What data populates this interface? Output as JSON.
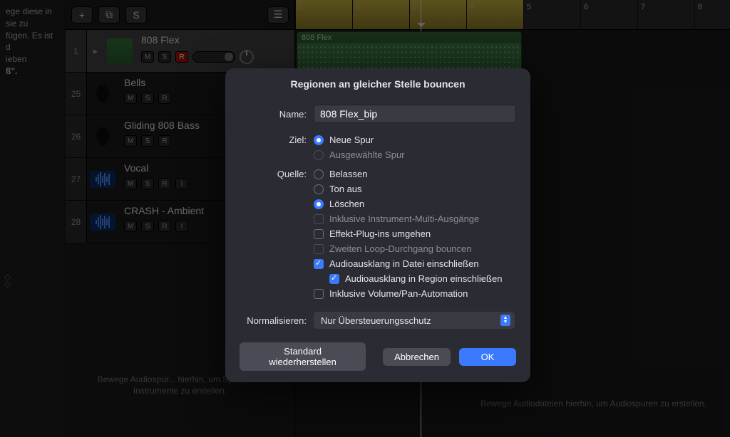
{
  "leftPanel": {
    "hint_lines": [
      "ege diese in",
      "sie zu",
      "fügen. Es ist",
      "d",
      "ieben",
      "ß\"."
    ]
  },
  "toolbar": {
    "add": "+",
    "dup": "⧉",
    "solo": "S",
    "list": "☰"
  },
  "tracks": [
    {
      "index": "1",
      "name": "808 Flex",
      "iconType": "drumpad",
      "m": "M",
      "s": "S",
      "r": "R",
      "i": "",
      "rec": true,
      "hasExtras": true
    },
    {
      "index": "25",
      "name": "Bells",
      "iconType": "mic",
      "m": "M",
      "s": "S",
      "r": "R",
      "i": "",
      "rec": false,
      "hasExtras": false
    },
    {
      "index": "26",
      "name": "Gliding 808 Bass",
      "iconType": "mic",
      "m": "M",
      "s": "S",
      "r": "R",
      "i": "",
      "rec": false,
      "hasExtras": false
    },
    {
      "index": "27",
      "name": "Vocal",
      "iconType": "wave",
      "m": "M",
      "s": "S",
      "r": "R",
      "i": "I",
      "rec": false,
      "hasExtras": false
    },
    {
      "index": "28",
      "name": "CRASH - Ambient",
      "iconType": "wave",
      "m": "M",
      "s": "S",
      "r": "R",
      "i": "I",
      "rec": false,
      "hasExtras": false
    }
  ],
  "trackAreaHint": "Bewege Audiospur... hierhin, um Spuren für Instrumente zu erstellen.",
  "timeline": {
    "bars": [
      "1",
      "2",
      "3",
      "4",
      "5",
      "6",
      "7",
      "8"
    ],
    "barWidth": 80,
    "loopEndBar": 5,
    "playheadBar": 3.2,
    "region": {
      "label": "808 Flex",
      "startBar": 1,
      "endBar": 5
    }
  },
  "arrangeHint": "Bewege Audiodateien hierhin, um Audiospuren zu erstellen.",
  "dialog": {
    "title": "Regionen an gleicher Stelle bouncen",
    "nameLabel": "Name:",
    "nameValue": "808 Flex_bip",
    "zielLabel": "Ziel:",
    "ziel": {
      "neueSpur": "Neue Spur",
      "ausgewaehlteSpur": "Ausgewählte Spur",
      "selected": "neueSpur"
    },
    "quelleLabel": "Quelle:",
    "quelle": {
      "belassen": "Belassen",
      "tonAus": "Ton aus",
      "loeschen": "Löschen",
      "selected": "loeschen"
    },
    "checks": {
      "multi": {
        "label": "Inklusive Instrument-Multi-Ausgänge",
        "checked": false,
        "disabled": true
      },
      "bypassFx": {
        "label": "Effekt-Plug-ins umgehen",
        "checked": false,
        "disabled": false
      },
      "secondLoop": {
        "label": "Zweiten Loop-Durchgang bouncen",
        "checked": false,
        "disabled": true
      },
      "tailInFile": {
        "label": "Audioausklang in Datei einschließen",
        "checked": true,
        "disabled": false
      },
      "tailInRegion": {
        "label": "Audioausklang in Region einschließen",
        "checked": true,
        "disabled": false
      },
      "volumePan": {
        "label": "Inklusive Volume/Pan-Automation",
        "checked": false,
        "disabled": false
      }
    },
    "normalizeLabel": "Normalisieren:",
    "normalizeValue": "Nur Übersteuerungsschutz",
    "buttons": {
      "reset": "Standard wiederherstellen",
      "cancel": "Abbrechen",
      "ok": "OK"
    }
  }
}
